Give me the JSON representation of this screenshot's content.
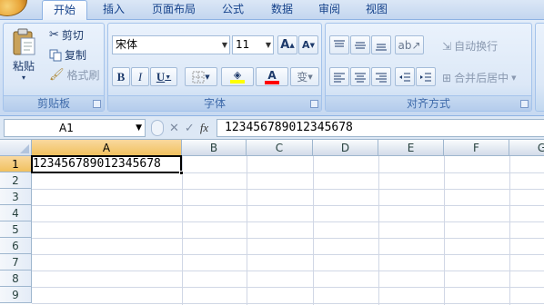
{
  "tabs": [
    {
      "label": "开始",
      "active": true
    },
    {
      "label": "插入",
      "active": false
    },
    {
      "label": "页面布局",
      "active": false
    },
    {
      "label": "公式",
      "active": false
    },
    {
      "label": "数据",
      "active": false
    },
    {
      "label": "审阅",
      "active": false
    },
    {
      "label": "视图",
      "active": false
    }
  ],
  "ribbon": {
    "clipboard": {
      "group_label": "剪贴板",
      "paste": "粘贴",
      "cut": "剪切",
      "copy": "复制",
      "format_painter": "格式刷"
    },
    "font": {
      "group_label": "字体",
      "font_name": "宋体",
      "font_size": "11",
      "grow_font": "A",
      "shrink_font": "A",
      "bold": "B",
      "italic": "I",
      "underline": "U",
      "font_color": "A",
      "phonetic": "变"
    },
    "alignment": {
      "group_label": "对齐方式",
      "wrap_text": "自动换行",
      "merge_center": "合并后居中"
    }
  },
  "formula_bar": {
    "name_box": "A1",
    "fx": "fx",
    "value": "123456789012345678"
  },
  "sheet": {
    "columns": [
      "A",
      "B",
      "C",
      "D",
      "E",
      "F",
      "G"
    ],
    "rows": [
      "1",
      "2",
      "3",
      "4",
      "5",
      "6",
      "7",
      "8",
      "9"
    ],
    "selected_cell": "A1",
    "a1_value": "123456789012345678"
  },
  "colors": {
    "accent": "#15428b",
    "header_selected": "#f1c15f",
    "font_color_bar": "#ff0000",
    "highlight_bar": "#ffff00"
  }
}
